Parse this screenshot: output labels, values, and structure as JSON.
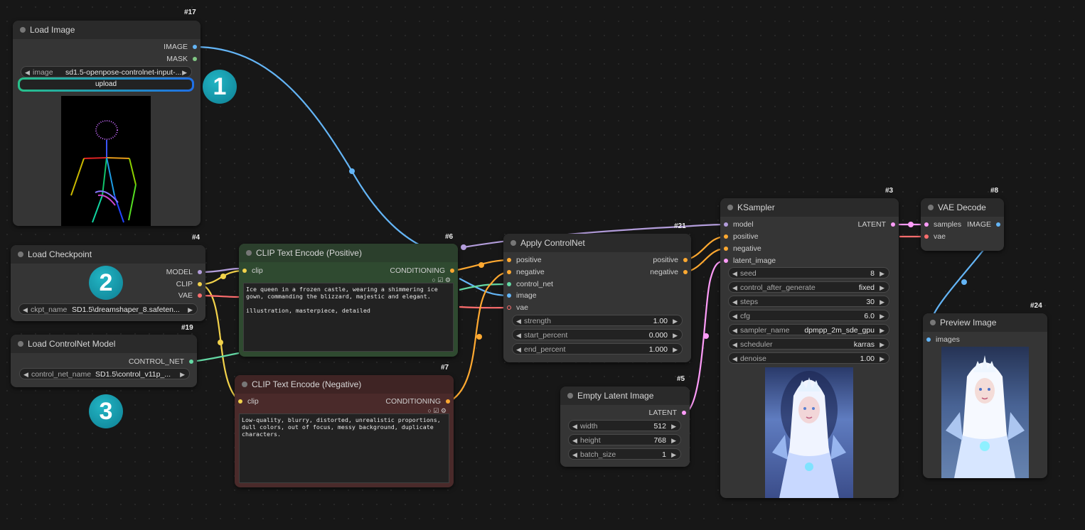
{
  "colors": {
    "clip": "#f2d24b",
    "model": "#b39ddb",
    "vae": "#ff6e6e",
    "conditioning": "#ffa931",
    "latent": "#ff9cf9",
    "image": "#64b5f6",
    "control_net": "#64d8a4",
    "mask": "#81c784"
  },
  "steps": [
    "1",
    "2",
    "3"
  ],
  "load_image": {
    "id": "#17",
    "title": "Load Image",
    "out_image": "IMAGE",
    "out_mask": "MASK",
    "image_label": "image",
    "image_value": "sd1.5-openpose-controlnet-input-...",
    "upload": "upload"
  },
  "load_checkpoint": {
    "id": "#4",
    "title": "Load Checkpoint",
    "out_model": "MODEL",
    "out_clip": "CLIP",
    "out_vae": "VAE",
    "ckpt_label": "ckpt_name",
    "ckpt_value": "SD1.5\\dreamshaper_8.safeten..."
  },
  "load_controlnet": {
    "id": "#19",
    "title": "Load ControlNet Model",
    "out_cn": "CONTROL_NET",
    "cn_label": "control_net_name",
    "cn_value": "SD1.5\\control_v11p_..."
  },
  "clip_pos": {
    "id": "#6",
    "title": "CLIP Text Encode (Positive)",
    "in_clip": "clip",
    "out_cond": "CONDITIONING",
    "text": "Ice queen in a frozen castle, wearing a shimmering ice\ngown, commanding the blizzard, majestic and elegant.\n\nillustration, masterpiece, detailed"
  },
  "clip_neg": {
    "id": "#7",
    "title": "CLIP Text Encode (Negative)",
    "in_clip": "clip",
    "out_cond": "CONDITIONING",
    "text": "Low-quality, blurry, distorted, unrealistic proportions,\ndull colors, out of focus, messy background, duplicate\ncharacters."
  },
  "apply_cn": {
    "id": "#21",
    "title": "Apply ControlNet",
    "in_positive": "positive",
    "in_negative": "negative",
    "in_cn": "control_net",
    "in_image": "image",
    "in_vae": "vae",
    "out_positive": "positive",
    "out_negative": "negative",
    "widgets": [
      {
        "label": "strength",
        "value": "1.00"
      },
      {
        "label": "start_percent",
        "value": "0.000"
      },
      {
        "label": "end_percent",
        "value": "1.000"
      }
    ]
  },
  "empty_latent": {
    "id": "#5",
    "title": "Empty Latent Image",
    "out_latent": "LATENT",
    "widgets": [
      {
        "label": "width",
        "value": "512"
      },
      {
        "label": "height",
        "value": "768"
      },
      {
        "label": "batch_size",
        "value": "1"
      }
    ]
  },
  "ksampler": {
    "id": "#3",
    "title": "KSampler",
    "in_model": "model",
    "in_positive": "positive",
    "in_negative": "negative",
    "in_latent": "latent_image",
    "out_latent": "LATENT",
    "widgets": [
      {
        "label": "seed",
        "value": "8"
      },
      {
        "label": "control_after_generate",
        "value": "fixed"
      },
      {
        "label": "steps",
        "value": "30"
      },
      {
        "label": "cfg",
        "value": "6.0"
      },
      {
        "label": "sampler_name",
        "value": "dpmpp_2m_sde_gpu"
      },
      {
        "label": "scheduler",
        "value": "karras"
      },
      {
        "label": "denoise",
        "value": "1.00"
      }
    ]
  },
  "vae_decode": {
    "id": "#8",
    "title": "VAE Decode",
    "in_samples": "samples",
    "in_vae": "vae",
    "out_image": "IMAGE"
  },
  "preview": {
    "id": "#24",
    "title": "Preview Image",
    "in_images": "images"
  }
}
